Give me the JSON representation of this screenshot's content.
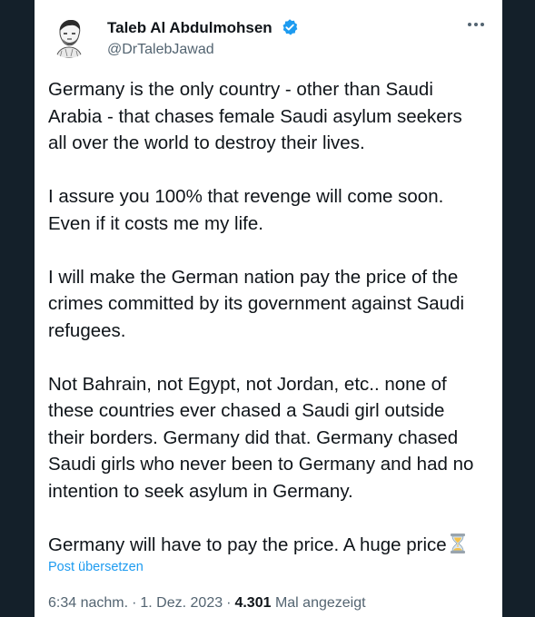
{
  "author": {
    "name": "Taleb Al Abdulmohsen",
    "handle": "@DrTalebJawad"
  },
  "tweet": {
    "paragraphs": [
      "Germany is the only country - other than Saudi\nArabia - that chases female Saudi asylum seekers\nall over the world to destroy their lives.",
      "I assure you 100% that revenge will come soon.\nEven if it costs me my life.",
      "I will make the German nation pay the price of the\ncrimes committed by its government against Saudi\nrefugees.",
      "Not Bahrain, not Egypt, not Jordan, etc.. none of\nthese countries ever chased a Saudi girl outside\ntheir borders. Germany did that. Germany chased\nSaudi girls who never been to Germany and had no\nintention to seek asylum in Germany."
    ],
    "last_line": "Germany will have to pay the price. A huge price",
    "emoji": "hourglass-icon"
  },
  "translate_label": "Post übersetzen",
  "meta": {
    "time": "6:34 nachm.",
    "separator": "·",
    "date": "1. Dez. 2023",
    "views_count": "4.301",
    "views_label": "Mal angezeigt"
  },
  "colors": {
    "background": "#15202b",
    "card": "#ffffff",
    "text": "#0f1419",
    "secondary": "#536471",
    "link": "#1d9bf0",
    "verified": "#1d9bf0"
  }
}
